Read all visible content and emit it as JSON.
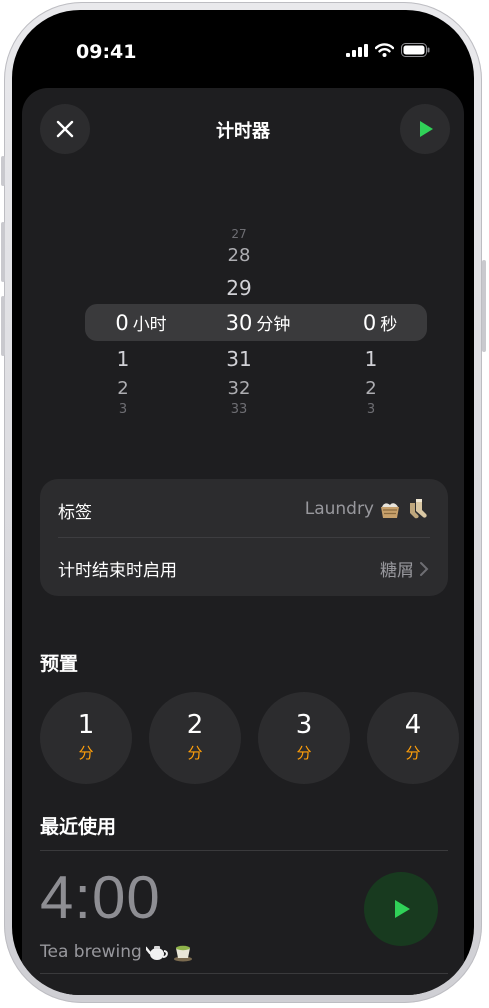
{
  "status_bar": {
    "time": "09:41"
  },
  "header": {
    "title": "计时器"
  },
  "picker": {
    "hours": {
      "above": [],
      "selected": "0",
      "unit": "小时",
      "below": [
        "1",
        "2",
        "3"
      ]
    },
    "minutes": {
      "above": [
        "27",
        "28",
        "29"
      ],
      "selected": "30",
      "unit": "分钟",
      "below": [
        "31",
        "32",
        "33"
      ]
    },
    "seconds": {
      "above": [],
      "selected": "0",
      "unit": "秒",
      "below": [
        "1",
        "2",
        "3"
      ]
    }
  },
  "settings": {
    "label_row": {
      "label": "标签",
      "value": "Laundry"
    },
    "end_row": {
      "label": "计时结束时启用",
      "value": "糖屑"
    }
  },
  "presets": {
    "title": "预置",
    "items": [
      {
        "value": "1",
        "unit": "分"
      },
      {
        "value": "2",
        "unit": "分"
      },
      {
        "value": "3",
        "unit": "分"
      },
      {
        "value": "4",
        "unit": "分"
      }
    ]
  },
  "recents": {
    "title": "最近使用",
    "items": [
      {
        "time": "4:00",
        "label": "Tea brewing"
      }
    ]
  },
  "colors": {
    "accent_green": "#30d158",
    "accent_orange": "#ff9f0a"
  }
}
